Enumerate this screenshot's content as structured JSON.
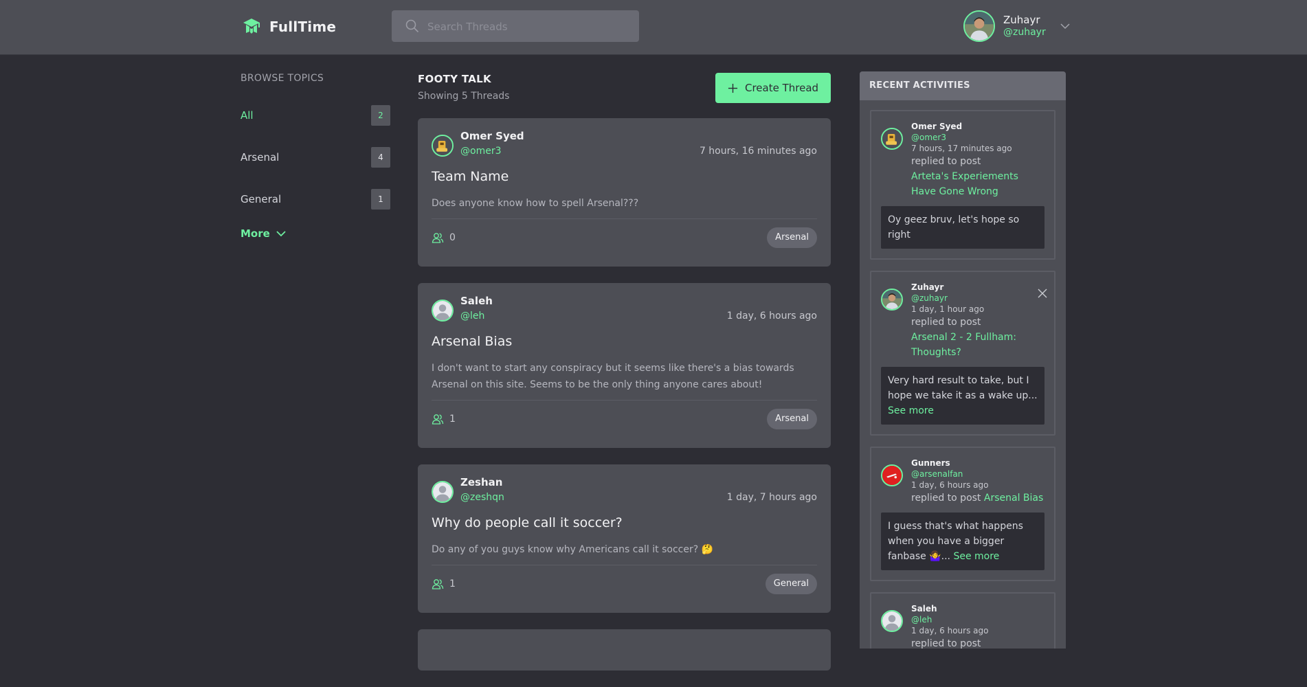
{
  "app": {
    "name": "FullTime",
    "logo_icon": "graduation-cap-logo",
    "accent": "#6ef0a0"
  },
  "search": {
    "placeholder": "Search Threads",
    "value": ""
  },
  "user": {
    "name": "Zuhayr",
    "handle": "@zuhayr"
  },
  "sidebar": {
    "title": "BROWSE TOPICS",
    "topics": [
      {
        "label": "All",
        "count": "2",
        "active": true
      },
      {
        "label": "Arsenal",
        "count": "4",
        "active": false
      },
      {
        "label": "General",
        "count": "1",
        "active": false
      }
    ],
    "more_label": "More"
  },
  "feed": {
    "title": "FOOTY TALK",
    "subtitle": "Showing 5 Threads",
    "create_label": "Create Thread",
    "threads": [
      {
        "author": "Omer Syed",
        "handle": "@omer3",
        "time": "7 hours, 16 minutes ago",
        "title": "Team Name",
        "body": "Does anyone know how to spell Arsenal???",
        "participants": "0",
        "tag": "Arsenal"
      },
      {
        "author": "Saleh",
        "handle": "@leh",
        "time": "1 day, 6 hours ago",
        "title": "Arsenal Bias",
        "body": "I don't want to start any conspiracy but it seems like there's a bias towards Arsenal on this site. Seems to be the only thing anyone cares about!",
        "participants": "1",
        "tag": "Arsenal"
      },
      {
        "author": "Zeshan",
        "handle": "@zeshqn",
        "time": "1 day, 7 hours ago",
        "title": "Why do people call it soccer?",
        "body": "Do any of you guys know why Americans call it soccer? 🤔",
        "participants": "1",
        "tag": "General"
      }
    ]
  },
  "recent": {
    "title": "RECENT ACTIVITIES",
    "items": [
      {
        "name": "Omer Syed",
        "handle": "@omer3",
        "time": "7 hours, 17 minutes ago",
        "action": "replied to post",
        "post": "Arteta's Experiements Have Gone Wrong",
        "quote": "Oy geez bruv, let's hope so right",
        "see_more": ""
      },
      {
        "name": "Zuhayr",
        "handle": "@zuhayr",
        "time": "1 day, 1 hour ago",
        "action": "replied to post",
        "post": "Arsenal 2 - 2 Fullham: Thoughts?",
        "quote": "Very hard result to take, but I hope we take it as a wake up...",
        "see_more": "See more"
      },
      {
        "name": "Gunners",
        "handle": "@arsenalfan",
        "time": "1 day, 6 hours ago",
        "action": "replied to post",
        "post": "Arsenal Bias",
        "quote": "I guess that's what happens when you have a bigger fanbase 🤷‍♀️...",
        "see_more": "See more"
      },
      {
        "name": "Saleh",
        "handle": "@leh",
        "time": "1 day, 6 hours ago",
        "action": "replied to post",
        "post": "",
        "quote": "",
        "see_more": ""
      }
    ]
  }
}
